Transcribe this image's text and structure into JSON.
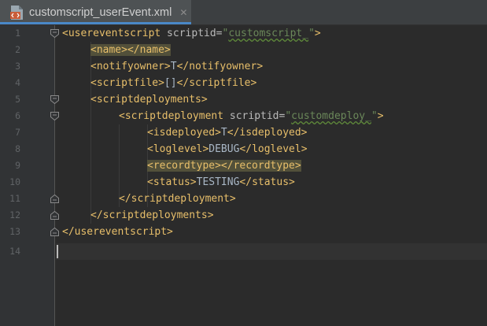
{
  "tab": {
    "title": "customscript_userEvent.xml",
    "close_glyph": "✕",
    "icon": "xml-file-icon"
  },
  "line_numbers": [
    "1",
    "2",
    "3",
    "4",
    "5",
    "6",
    "7",
    "8",
    "9",
    "10",
    "11",
    "12",
    "13",
    "14"
  ],
  "code": {
    "l1_open": "<",
    "l1_tag": "usereventscript",
    "l1_attr": " scriptid=",
    "l1_val_a": "\"",
    "l1_val_b": "customscript_",
    "l1_val_c": "\"",
    "l1_close": ">",
    "l2_a": "<name>",
    "l2_b": "</name>",
    "l3_a": "<notifyowner>",
    "l3_text": "T",
    "l3_b": "</notifyowner>",
    "l4_a": "<scriptfile>",
    "l4_text": "[]",
    "l4_b": "</scriptfile>",
    "l5_a": "<scriptdeployments>",
    "l6_open": "<",
    "l6_tag": "scriptdeployment",
    "l6_attr": " scriptid=",
    "l6_val_a": "\"",
    "l6_val_b": "customdeploy_",
    "l6_val_c": "\"",
    "l6_close": ">",
    "l7_a": "<isdeployed>",
    "l7_text": "T",
    "l7_b": "</isdeployed>",
    "l8_a": "<loglevel>",
    "l8_text": "DEBUG",
    "l8_b": "</loglevel>",
    "l9_a": "<recordtype>",
    "l9_b": "</recordtype>",
    "l10_a": "<status>",
    "l10_text": "TESTING",
    "l10_b": "</status>",
    "l11_a": "</scriptdeployment>",
    "l12_a": "</scriptdeployments>",
    "l13_a": "</usereventscript>"
  },
  "colors": {
    "background": "#2b2b2b",
    "tag": "#e8bf6a",
    "attribute": "#bababa",
    "value": "#6a8759",
    "text": "#a9b7c6",
    "tag_highlight": "#52503a",
    "tab_underline": "#4a88c7"
  }
}
